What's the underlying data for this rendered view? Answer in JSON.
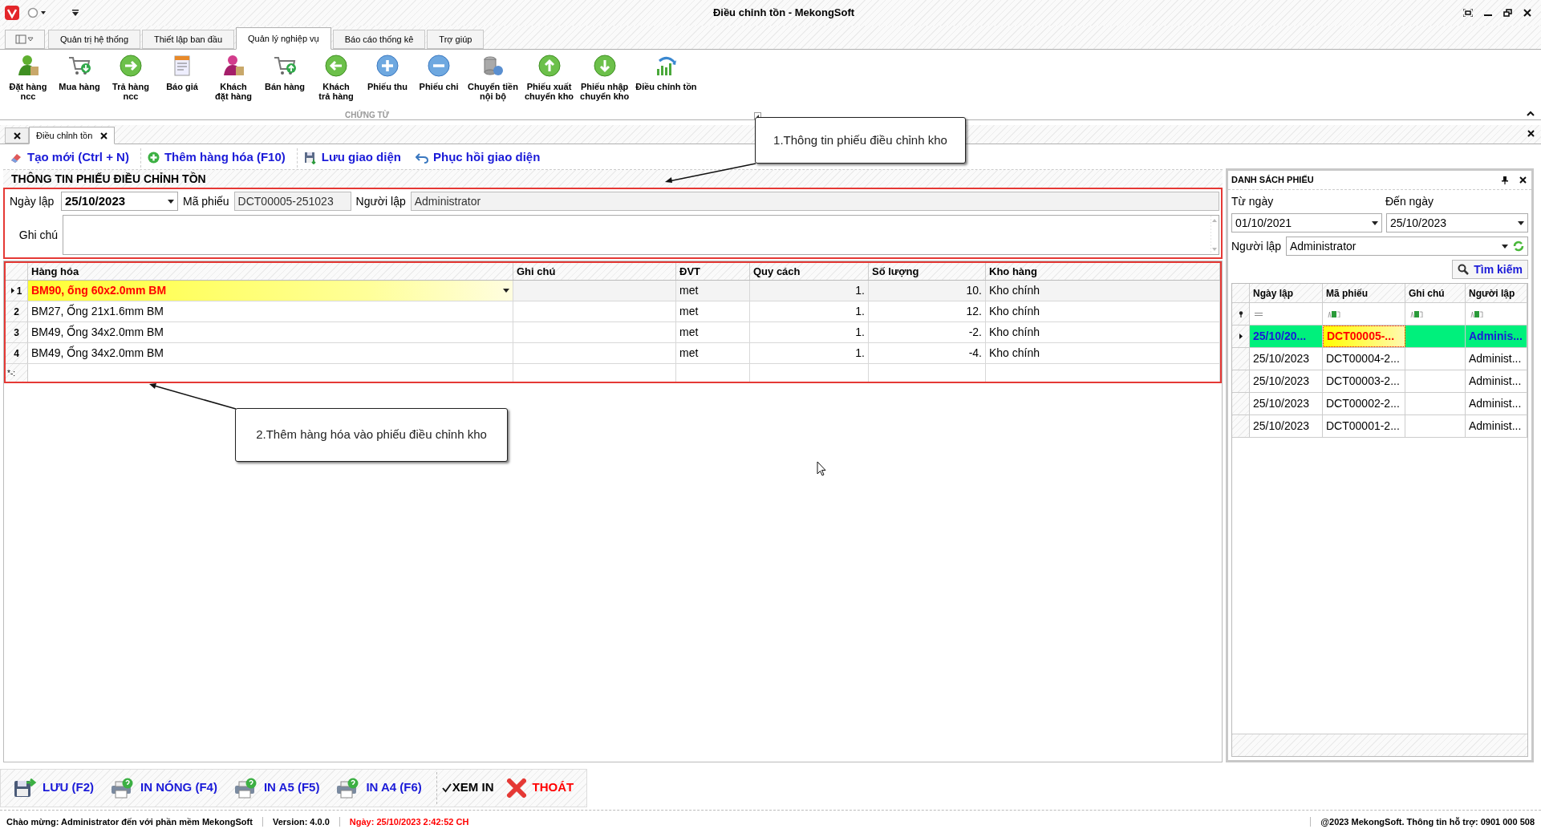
{
  "window": {
    "title": "Điều chỉnh tồn - MekongSoft"
  },
  "ribbon_tabs": [
    {
      "label": "Quản trị hệ thống",
      "selected": false
    },
    {
      "label": "Thiết lập ban đầu",
      "selected": false
    },
    {
      "label": "Quản lý nghiệp vụ",
      "selected": true
    },
    {
      "label": "Báo cáo thống kê",
      "selected": false
    },
    {
      "label": "Trợ giúp",
      "selected": false
    }
  ],
  "ribbon_buttons": [
    "Đặt hàng\nncc",
    "Mua hàng",
    "Trả hàng\nncc",
    "Báo giá",
    "Khách\nđặt hàng",
    "Bán hàng",
    "Khách\ntrả hàng",
    "Phiếu thu",
    "Phiếu chi",
    "Chuyển tiền\nnội bộ",
    "Phiếu xuất\nchuyển kho",
    "Phiếu nhập\nchuyển kho",
    "Điều chỉnh tồn"
  ],
  "ribbon_group": "CHỨNG TỪ",
  "document_tabs": [
    {
      "label": "Điều chỉnh tồn",
      "selected": true
    }
  ],
  "toolbar": [
    "Tạo mới (Ctrl + N)",
    "Thêm hàng hóa (F10)",
    "Lưu giao diện",
    "Phục hồi giao diện"
  ],
  "section_title": "THÔNG TIN PHIẾU ĐIỀU CHỈNH TỒN",
  "form": {
    "date_label": "Ngày lập",
    "date": "25/10/2023",
    "code_label": "Mã phiếu",
    "code": "DCT00005-251023",
    "creator_label": "Người lập",
    "creator": "Administrator",
    "note_label": "Ghi chú"
  },
  "grid": {
    "columns": [
      "Hàng hóa",
      "Ghi chú",
      "ĐVT",
      "Quy cách",
      "Số lượng",
      "Kho hàng"
    ],
    "rows": [
      {
        "number": "1",
        "selected": true,
        "cells": [
          "BM90, ống 60x2.0mm BM",
          "",
          "met",
          "1.",
          "10.",
          "Kho chính"
        ]
      },
      {
        "number": "2",
        "selected": false,
        "cells": [
          "BM27, Ống 21x1.6mm BM",
          "",
          "met",
          "1.",
          "12.",
          "Kho chính"
        ]
      },
      {
        "number": "3",
        "selected": false,
        "cells": [
          "BM49, Ống 34x2.0mm BM",
          "",
          "met",
          "1.",
          "-2.",
          "Kho chính"
        ]
      },
      {
        "number": "4",
        "selected": false,
        "cells": [
          "BM49, Ống 34x2.0mm BM",
          "",
          "met",
          "1.",
          "-4.",
          "Kho chính"
        ]
      }
    ],
    "new_row_marker": "*-:"
  },
  "callouts": [
    {
      "text": "1.Thông tin phiếu điều chỉnh kho"
    },
    {
      "text": "2.Thêm hàng hóa vào phiếu điều chỉnh kho"
    }
  ],
  "list_panel": {
    "title": "DANH SÁCH PHIẾU",
    "from_label": "Từ ngày",
    "from": "01/10/2021",
    "to_label": "Đến ngày",
    "to": "25/10/2023",
    "creator_label": "Người lập",
    "creator": "Administrator",
    "search_button": "Tìm kiếm",
    "columns": [
      "Ngày lập",
      "Mã phiếu",
      "Ghi chú",
      "Người lập"
    ],
    "rows": [
      {
        "selected": true,
        "cells": [
          "25/10/20...",
          "DCT00005-...",
          "",
          "Adminis..."
        ]
      },
      {
        "selected": false,
        "cells": [
          "25/10/2023",
          "DCT00004-2...",
          "",
          "Administ..."
        ]
      },
      {
        "selected": false,
        "cells": [
          "25/10/2023",
          "DCT00003-2...",
          "",
          "Administ..."
        ]
      },
      {
        "selected": false,
        "cells": [
          "25/10/2023",
          "DCT00002-2...",
          "",
          "Administ..."
        ]
      },
      {
        "selected": false,
        "cells": [
          "25/10/2023",
          "DCT00001-2...",
          "",
          "Administ..."
        ]
      }
    ]
  },
  "bottom_buttons": [
    {
      "label": "LƯU (F2)",
      "kind": "save"
    },
    {
      "label": "IN NÓNG (F4)",
      "kind": "print"
    },
    {
      "label": "IN A5 (F5)",
      "kind": "print"
    },
    {
      "label": "IN A4 (F6)",
      "kind": "print"
    },
    {
      "label": "XEM IN",
      "kind": "check",
      "checked": true
    },
    {
      "label": "THOÁT",
      "kind": "exit"
    }
  ],
  "status": [
    {
      "text": "Chào mừng: Administrator đến với phần mềm MekongSoft",
      "kind": "normal"
    },
    {
      "text": "Version: 4.0.0",
      "kind": "normal"
    },
    {
      "text": "Ngày: 25/10/2023 2:42:52 CH",
      "kind": "alert"
    }
  ],
  "status_right": "@2023 MekongSoft. Thông tin hỗ trợ: 0901 000 508"
}
